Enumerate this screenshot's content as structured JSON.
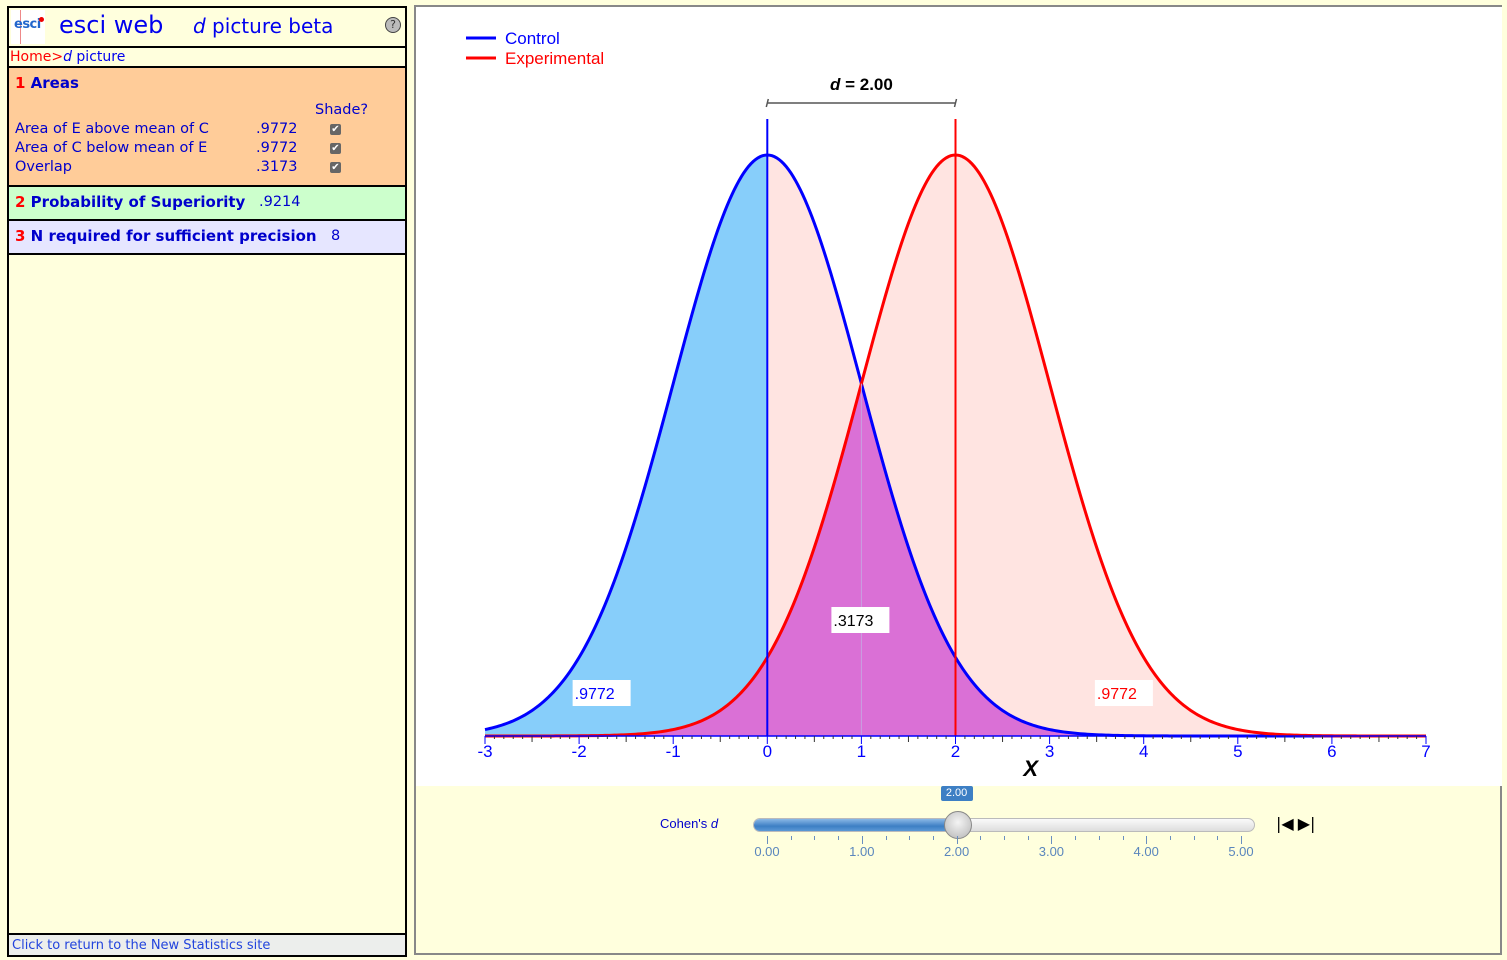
{
  "header": {
    "logo_text": "esci",
    "app_title": "esci web",
    "page_title_italic": "d",
    "page_title_rest": " picture beta",
    "help_icon": "?"
  },
  "breadcrumb": {
    "home": "Home",
    "separator": ">",
    "current_italic": "d",
    "current_rest": " picture"
  },
  "sections": {
    "areas": {
      "number": "1",
      "title": "Areas",
      "shade_header": "Shade?",
      "rows": [
        {
          "label": "Area of E above mean of C",
          "value": ".9772",
          "shade": true
        },
        {
          "label": "Area of C below mean of E",
          "value": ".9772",
          "shade": true
        },
        {
          "label": "Overlap",
          "value": ".3173",
          "shade": true
        }
      ]
    },
    "superiority": {
      "number": "2",
      "title": "Probability of Superiority",
      "value": ".9214"
    },
    "n_required": {
      "number": "3",
      "title": "N required for sufficient precision",
      "value": "8"
    }
  },
  "footer": {
    "link": "Click to return to the New Statistics site"
  },
  "colors": {
    "control": "#0000FF",
    "experimental": "#FF0000",
    "control_fill": "#87CEFA",
    "experimental_fill": "#FFE4E1",
    "overlap_fill": "#DA70D6"
  },
  "slider": {
    "label_prefix": "Cohen's ",
    "label_italic": "d",
    "value": 2.0,
    "value_label": "2.00",
    "min": 0,
    "max": 5,
    "tick_labels": [
      "0.00",
      "1.00",
      "2.00",
      "3.00",
      "4.00",
      "5.00"
    ],
    "step_back_icon": "⏮",
    "step_fwd_icon": "⏭"
  },
  "chart_data": {
    "type": "area",
    "title": "d = 2.00",
    "d": 2.0,
    "xlabel": "X",
    "xlim": [
      -3,
      7
    ],
    "x_ticks": [
      "-3",
      "-2",
      "-1",
      "0",
      "1",
      "2",
      "3",
      "4",
      "5",
      "6",
      "7"
    ],
    "legend": [
      {
        "name": "Control",
        "color": "#0000FF"
      },
      {
        "name": "Experimental",
        "color": "#FF0000"
      }
    ],
    "legend_position": "top-left",
    "series": [
      {
        "name": "Control",
        "distribution": "normal",
        "mean": 0,
        "sd": 1
      },
      {
        "name": "Experimental",
        "distribution": "normal",
        "mean": 2,
        "sd": 1
      }
    ],
    "annotations": [
      {
        "label": ".9772",
        "region": "Control area below mean of E",
        "color": "#0000FF",
        "x": -1.75
      },
      {
        "label": ".3173",
        "region": "Overlap",
        "color": "#000000",
        "x": 1.0
      },
      {
        "label": ".9772",
        "region": "Experimental area above mean of C",
        "color": "#FF0000",
        "x": 3.8
      }
    ]
  }
}
